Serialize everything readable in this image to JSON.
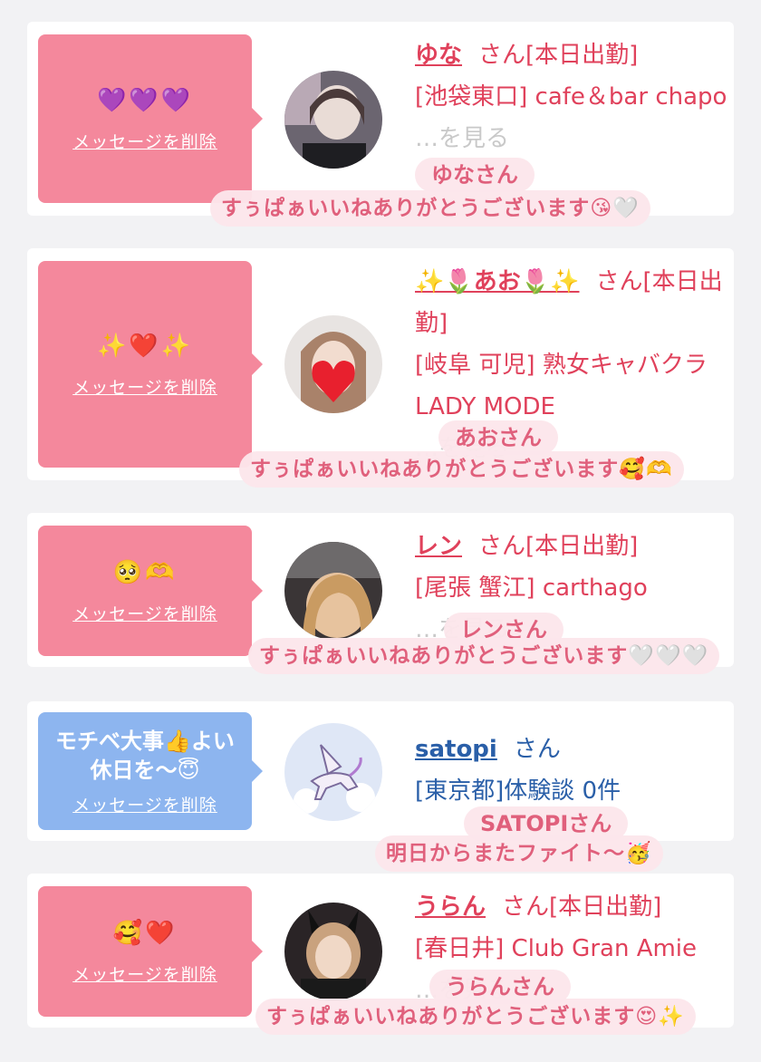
{
  "delete_label": "メッセージを削除",
  "suffix": "さん",
  "colors": {
    "accent": "#e0415b",
    "bubble_pink": "#f4889c",
    "bubble_blue": "#8db5ef",
    "link_blue": "#2a5fa8"
  },
  "cards": [
    {
      "message": "💜💜💜",
      "name": "ゆな",
      "shift": "[本日出勤]",
      "shop": "[池袋東口] cafe＆bar chapo",
      "faded": "…を見る",
      "caption_name": "ゆなさん",
      "caption_text": "すぅぱぁいいねありがとうございます😘🤍"
    },
    {
      "message": "✨❤️✨",
      "name": "✨🌷あお🌷✨",
      "shift": "[本日出勤]",
      "shop": "[岐阜 可児] 熟女キャバクラ LADY MODE",
      "faded": "…を見る",
      "caption_name": "あおさん",
      "caption_text": "すぅぱぁいいねありがとうございます🥰🫶"
    },
    {
      "message": "🥺🫶",
      "name": "レン",
      "shift": "[本日出勤]",
      "shop": "[尾張 蟹江] carthago",
      "faded": "…を見る",
      "caption_name": "レンさん",
      "caption_text": "すぅぱぁいいねありがとうございます🤍🤍🤍"
    },
    {
      "message": "モチベ大事👍よい休日を〜😇",
      "name": "satopi",
      "shift": "",
      "shop": "[東京都]体験談 0件",
      "faded": "",
      "caption_name": "SATOPIさん",
      "caption_text": "明日からまたファイト〜🥳"
    },
    {
      "message": "🥰❤️",
      "name": "うらん",
      "shift": "[本日出勤]",
      "shop": "[春日井] Club Gran Amie",
      "faded": "…を見る",
      "caption_name": "うらんさん",
      "caption_text": "すぅぱぁいいねありがとうございます😍✨"
    }
  ]
}
